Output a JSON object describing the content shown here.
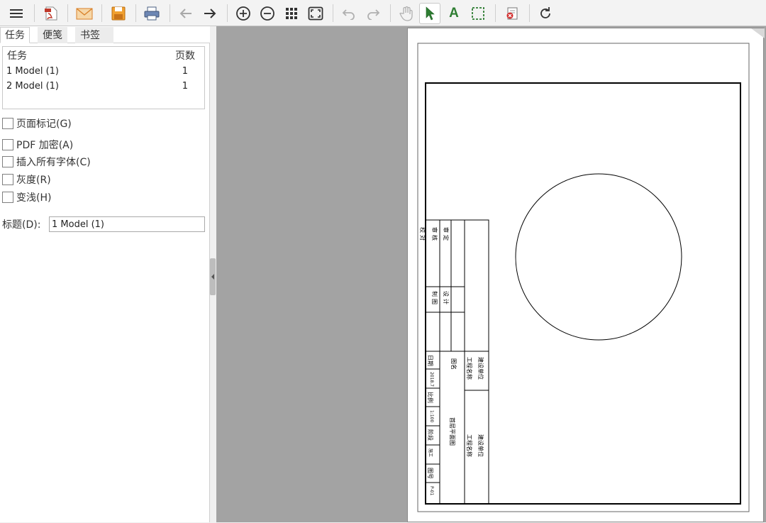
{
  "toolbar": {
    "icons": [
      "menu-icon",
      "pdf-icon",
      "email-icon",
      "save-icon",
      "print-icon",
      "back-arrow-icon",
      "forward-arrow-icon",
      "zoom-in-icon",
      "zoom-out-icon",
      "thumbnails-icon",
      "fit-page-icon",
      "undo-icon",
      "redo-icon",
      "hand-pan-icon",
      "select-pointer-icon",
      "text-tool-icon",
      "marquee-select-icon",
      "settings-icon",
      "refresh-icon"
    ],
    "selected_tool": "select-pointer-icon",
    "text_tool_label": "A"
  },
  "tabs": [
    {
      "label": "任务",
      "active": true
    },
    {
      "label": "便笺",
      "active": false
    },
    {
      "label": "书签",
      "active": false
    }
  ],
  "tasklist": {
    "col_task": "任务",
    "col_pages": "页数",
    "rows": [
      {
        "task": "1 Model (1)",
        "pages": "1"
      },
      {
        "task": "2 Model (1)",
        "pages": "1"
      }
    ]
  },
  "options": [
    {
      "label": "页面标记(G)",
      "checked": false
    },
    {
      "label": "PDF 加密(A)",
      "checked": false
    },
    {
      "label": "插入所有字体(C)",
      "checked": false
    },
    {
      "label": "灰度(R)",
      "checked": false
    },
    {
      "label": "变浅(H)",
      "checked": false
    }
  ],
  "title_field": {
    "label": "标题(D):",
    "value": "1 Model (1)"
  },
  "drawing": {
    "titleblock_top": [
      "审定",
      "审核",
      "校对"
    ],
    "titleblock_mid": [
      "设计",
      "制图"
    ],
    "titleblock_date_label": "日期",
    "titleblock_date": "2018.7",
    "titleblock_scale_label": "比例",
    "titleblock_scale": "1:100",
    "titleblock_stage_label": "阶段",
    "titleblock_stage": "施工",
    "titleblock_drawing_no_label": "图号",
    "titleblock_drawing_no": "P-01",
    "titleblock_drawing_name_label": "图名",
    "titleblock_drawing_name": "首层平面图",
    "titleblock_owner_label": "建设单位",
    "titleblock_project_label": "工程名称"
  }
}
